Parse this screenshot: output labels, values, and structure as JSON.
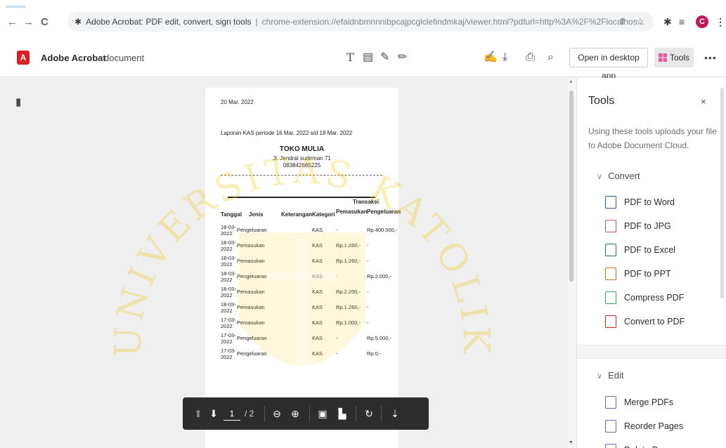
{
  "browser": {
    "back": "←",
    "forward": "→",
    "reload": "C",
    "ext_icon": "puzzle-icon",
    "address_title": "Adobe Acrobat: PDF edit, convert, sign tools",
    "address_sep": "|",
    "address_url": "chrome-extension://efaidnbmnnnibpcajpcglclefindmkaj/viewer.html?pdfurl=http%3A%2F%2Flocalhos...",
    "profile_initial": "C"
  },
  "acrobat": {
    "app_name": "Adobe Acrobat",
    "doc_name": "document",
    "open_desktop": "Open in desktop app",
    "tools_button": "Tools",
    "more": "•••"
  },
  "pdf": {
    "date": "20 Mar. 2022",
    "report": "Laporan KAS periode 16 Mar. 2022 s/d 18 Mar. 2022",
    "shop": "TOKO MULIA",
    "address": "Jl. Jendral sudirman 71",
    "phone": "083842665225",
    "headers": {
      "tanggal": "Tanggal",
      "jenis": "Jenis",
      "keterangan": "Keterangan",
      "kategori": "Kategori",
      "transaksi": "Transaksi",
      "pemasukan": "Pemasukan",
      "pengeluaran": "Pengeluaran"
    },
    "rows": [
      {
        "date1": "18-03-",
        "date2": "2022",
        "jenis": "Pengeluaran",
        "kategori": "KAS",
        "pemasukan": "-",
        "pengeluaran": "Rp.400.000,-"
      },
      {
        "date1": "18-03-",
        "date2": "2022",
        "jenis": "Pemasukan",
        "kategori": "KAS",
        "pemasukan": "Rp.1.260,-",
        "pengeluaran": "-"
      },
      {
        "date1": "18-03-",
        "date2": "2022",
        "jenis": "Pemasukan",
        "kategori": "KAS",
        "pemasukan": "Rp.1.260,-",
        "pengeluaran": "-"
      },
      {
        "date1": "18-03-",
        "date2": "2022",
        "jenis": "Pengeluaran",
        "kategori": "KAS",
        "pemasukan": "-",
        "pengeluaran": "Rp.2.000,-"
      },
      {
        "date1": "18-03-",
        "date2": "2022",
        "jenis": "Pemasukan",
        "kategori": "KAS",
        "pemasukan": "Rp.2.200,-",
        "pengeluaran": "-"
      },
      {
        "date1": "18-03-",
        "date2": "2022",
        "jenis": "Pemasukan",
        "kategori": "KAS",
        "pemasukan": "Rp.1.260,-",
        "pengeluaran": "-"
      },
      {
        "date1": "17-03-",
        "date2": "2022",
        "jenis": "Pemasukan",
        "kategori": "KAS",
        "pemasukan": "Rp.1.000,-",
        "pengeluaran": "-"
      },
      {
        "date1": "17-03-",
        "date2": "2022",
        "jenis": "Pengeluaran",
        "kategori": "KAS",
        "pemasukan": "-",
        "pengeluaran": "Rp.5.000,-"
      },
      {
        "date1": "17-03-",
        "date2": "2022",
        "jenis": "Pengeluaran",
        "kategori": "KAS",
        "pemasukan": "-",
        "pengeluaran": "Rp.0,-"
      }
    ]
  },
  "toolbar": {
    "page_current": "1",
    "page_total": "/ 2"
  },
  "watermark": {
    "text": "UNIVERSITAS KATOLIK",
    "color": "#f2c500"
  },
  "tools_panel": {
    "title": "Tools",
    "close": "×",
    "description": "Using these tools uploads your file to Adobe Document Cloud.",
    "convert_section": "Convert",
    "convert_items": [
      {
        "label": "PDF to Word",
        "color": "#2b579a"
      },
      {
        "label": "PDF to JPG",
        "color": "#d04a7c"
      },
      {
        "label": "PDF to Excel",
        "color": "#1e7e34"
      },
      {
        "label": "PDF to PPT",
        "color": "#d2691e"
      },
      {
        "label": "Compress PDF",
        "color": "#3a9e4c"
      },
      {
        "label": "Convert to PDF",
        "color": "#d71f26"
      }
    ],
    "edit_section": "Edit",
    "edit_items": [
      {
        "label": "Merge PDFs",
        "color": "#7d5cbf"
      },
      {
        "label": "Reorder Pages",
        "color": "#7d5cbf"
      },
      {
        "label": "Delete Pages",
        "color": "#7d5cbf"
      }
    ]
  }
}
